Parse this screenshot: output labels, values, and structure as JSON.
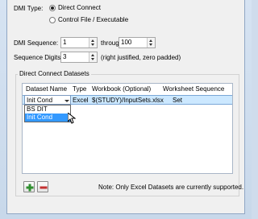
{
  "dmi_type": {
    "label": "DMI Type:",
    "options": [
      {
        "label": "Direct Connect",
        "selected": true
      },
      {
        "label": "Control File / Executable",
        "selected": false
      }
    ]
  },
  "dmi_sequence": {
    "label": "DMI Sequence:",
    "from_value": "1",
    "through_label": "through",
    "to_value": "100"
  },
  "sequence_digits": {
    "label": "Sequence Digits:",
    "value": "3",
    "hint": "(right justified, zero padded)"
  },
  "datasets": {
    "group_title": "Direct Connect Datasets",
    "columns": [
      "Dataset Name",
      "Type",
      "Workbook (Optional)",
      "Worksheet Sequence"
    ],
    "rows": [
      {
        "dataset_name": "Init Cond",
        "type": "Excel",
        "workbook": "$(STUDY)/InputSets.xlsx",
        "worksheet_sequence": "Set"
      }
    ],
    "dropdown_options": [
      "BS DIT",
      "Init Cond"
    ],
    "dropdown_selected": "Init Cond"
  },
  "buttons": {
    "add_icon": "plus-icon",
    "remove_icon": "minus-icon"
  },
  "note": "Note: Only Excel Datasets are currently supported.",
  "colors": {
    "selection_blue": "#3399ff",
    "row_highlight": "#cce8ff",
    "add_green": "#2f8f2f",
    "remove_red": "#c43030"
  }
}
